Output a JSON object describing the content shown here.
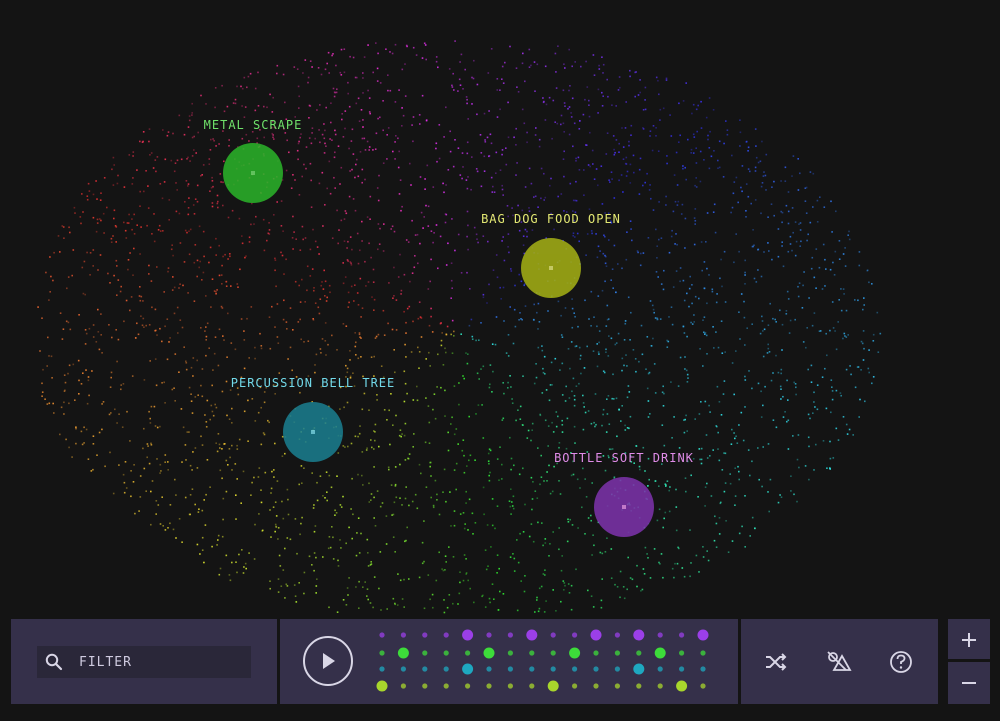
{
  "map": {
    "labels": [
      {
        "text": "METAL SCRAPE",
        "color": "#6fe06a",
        "circle_color": "#2bb52a"
      },
      {
        "text": "BAG DOG FOOD OPEN",
        "color": "#e3e873",
        "circle_color": "#a6b215"
      },
      {
        "text": "PERCUSSION BELL TREE",
        "color": "#72d9e9",
        "circle_color": "#1a7f91"
      },
      {
        "text": "BOTTLE SOFT DRINK",
        "color": "#e08ce8",
        "circle_color": "#7e33ad"
      }
    ]
  },
  "toolbar": {
    "filter_placeholder": "FILTER",
    "search_icon": "search-icon",
    "play_icon": "play-icon",
    "shuffle_icon": "shuffle-icon",
    "shapes_icon": "shapes-icon",
    "help_icon": "help-icon",
    "zoom_in_label": "+",
    "zoom_out_label": "–"
  },
  "sequencer": {
    "row_colors": [
      "#9b3fe8",
      "#3ddc3a",
      "#1ea8c0",
      "#a8d62c"
    ],
    "steps": 16,
    "active_steps": [
      [
        4,
        7,
        10,
        12,
        15
      ],
      [
        1,
        5,
        9,
        13
      ],
      [
        4,
        12
      ],
      [
        0,
        8,
        14
      ]
    ]
  }
}
